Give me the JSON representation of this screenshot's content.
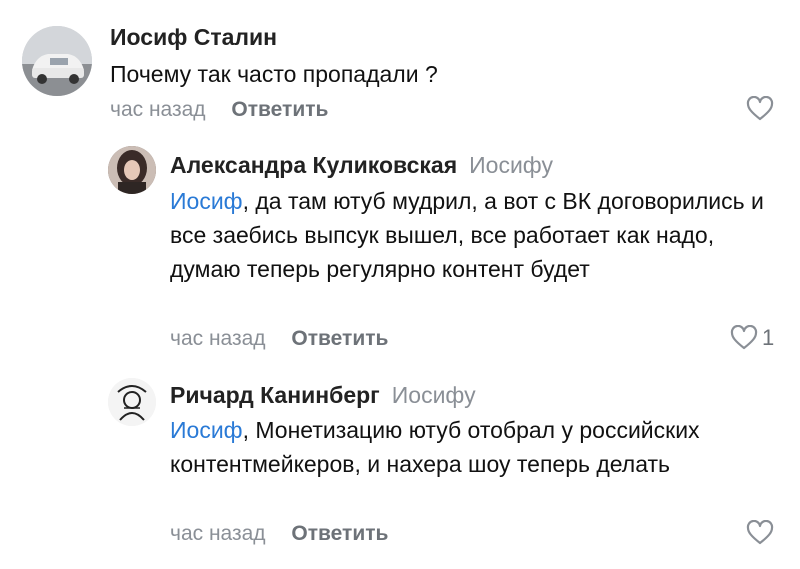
{
  "comments": [
    {
      "author": "Иосиф Сталин",
      "reply_to": "",
      "mention": "",
      "text": "Почему так часто пропадали ?",
      "time": "час назад",
      "reply_label": "Ответить",
      "likes": ""
    },
    {
      "author": "Александра Куликовская",
      "reply_to": "Иосифу",
      "mention": "Иосиф",
      "text": ", да там ютуб мудрил, а вот с ВК договорились и все заебись выпсук вышел, все работает как надо, думаю теперь регулярно контент будет",
      "time": "час назад",
      "reply_label": "Ответить",
      "likes": "1"
    },
    {
      "author": "Ричард Канинберг",
      "reply_to": "Иосифу",
      "mention": "Иосиф",
      "text": ", Монетизацию ютуб отобрал у российских контентмейкеров, и нахера шоу теперь делать",
      "time": "час назад",
      "reply_label": "Ответить",
      "likes": ""
    }
  ],
  "colors": {
    "mention": "#2a7ad6",
    "muted": "#8a8f96",
    "icon": "#8a8f96"
  },
  "icons": {
    "like": "heart-outline-icon"
  }
}
